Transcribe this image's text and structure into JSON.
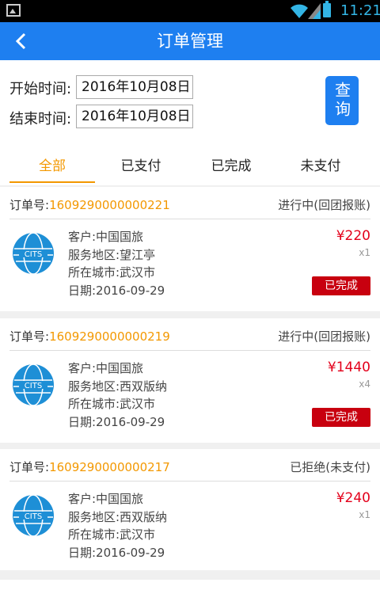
{
  "status_bar": {
    "time": "11:21"
  },
  "header": {
    "back_icon": "chevron-left-icon",
    "title": "订单管理"
  },
  "filter": {
    "start_label": "开始时间:",
    "start_value": "2016年10月08日",
    "end_label": "结束时间:",
    "end_value": "2016年10月08日",
    "query_label": "查询"
  },
  "tabs": [
    {
      "label": "全部",
      "active": true
    },
    {
      "label": "已支付",
      "active": false
    },
    {
      "label": "已完成",
      "active": false
    },
    {
      "label": "未支付",
      "active": false
    }
  ],
  "orders": [
    {
      "number_label": "订单号:",
      "number": "1609290000000221",
      "status": "进行中(回团报账)",
      "customer": "客户:中国国旅",
      "area": "服务地区:望江亭",
      "city": "所在城市:武汉市",
      "date": "日期:2016-09-29",
      "price": "¥220",
      "qty": "x1",
      "badge": "已完成"
    },
    {
      "number_label": "订单号:",
      "number": "1609290000000219",
      "status": "进行中(回团报账)",
      "customer": "客户:中国国旅",
      "area": "服务地区:西双版纳",
      "city": "所在城市:武汉市",
      "date": "日期:2016-09-29",
      "price": "¥1440",
      "qty": "x4",
      "badge": "已完成"
    },
    {
      "number_label": "订单号:",
      "number": "1609290000000217",
      "status": "已拒绝(未支付)",
      "customer": "客户:中国国旅",
      "area": "服务地区:西双版纳",
      "city": "所在城市:武汉市",
      "date": "日期:2016-09-29",
      "price": "¥240",
      "qty": "x1",
      "badge": ""
    }
  ],
  "colors": {
    "primary": "#1e7ff0",
    "accent": "#f39800",
    "price": "#e3001b",
    "badge": "#c8000f"
  },
  "logo_icon": "cits-globe-logo-icon"
}
